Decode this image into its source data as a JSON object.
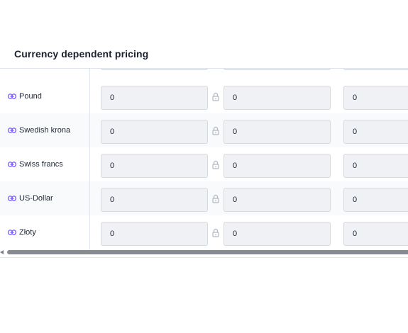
{
  "title": "Currency dependent pricing",
  "rows": [
    {
      "currency": "Pound",
      "values": [
        "0",
        "0",
        "0"
      ]
    },
    {
      "currency": "Swedish krona",
      "values": [
        "0",
        "0",
        "0"
      ]
    },
    {
      "currency": "Swiss francs",
      "values": [
        "0",
        "0",
        "0"
      ]
    },
    {
      "currency": "US-Dollar",
      "values": [
        "0",
        "0",
        "0"
      ]
    },
    {
      "currency": "Złoty",
      "values": [
        "0",
        "0",
        "0"
      ]
    }
  ],
  "icons": {
    "link": "link-icon",
    "lock": "lock-icon"
  },
  "colors": {
    "link_icon": "#7c5cff",
    "lock_icon": "#b0b6c0",
    "field_bg": "#f0f1f4"
  }
}
